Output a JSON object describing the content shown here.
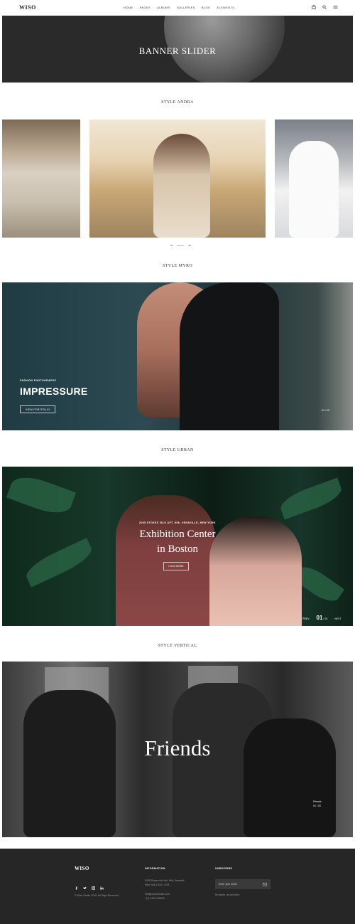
{
  "header": {
    "logo": "WISO",
    "nav": [
      "HOME",
      "PAGES",
      "ALBUMS",
      "GALLERIES",
      "BLOG",
      "ELEMENTS"
    ],
    "icons": [
      "bag-icon",
      "search-icon",
      "menu-icon"
    ]
  },
  "banner": {
    "title": "BANNER SLIDER"
  },
  "sections": {
    "andra": "STYLE ANDRA",
    "myro": "STYLE MYRO",
    "urban": "STYLE URBAN",
    "vertical": "STYLE VERTICAL"
  },
  "andra": {
    "pager_current": "01",
    "pager_total": "03"
  },
  "myro": {
    "kicker": "FASHION PHOTOGRAPHY",
    "title": "IMPRESSURE",
    "button": "VIEW PORTFOLIO",
    "pager": "01 / 03"
  },
  "urban": {
    "kicker": "2085 STOKES ISLE APT. 896, VENAVILLE, NEW YORK",
    "title_line1": "Exhibition Center",
    "title_line2": "in Boston",
    "button": "LOOK MORE",
    "prev": "PREV",
    "current": "01",
    "total": "/ 03",
    "next": "NEXT"
  },
  "vertical": {
    "title": "Friends",
    "side_title": "Friends",
    "side_pager": "01 / 03"
  },
  "footer": {
    "logo": "WISO",
    "copyright": "© Wiso Studio 2018. All Right Reserved.",
    "info_title": "INFORMATION",
    "address_line1": "2005 Stokes Isle Apt. 896, Venaville",
    "address_line2": "New York 10010, USA",
    "email": "info@yourdomain.com",
    "phone": "+(1) 1230 345690",
    "subscribe_title": "SUBSCRIBE",
    "email_placeholder": "Enter your email",
    "note": "No spam, we promise."
  }
}
